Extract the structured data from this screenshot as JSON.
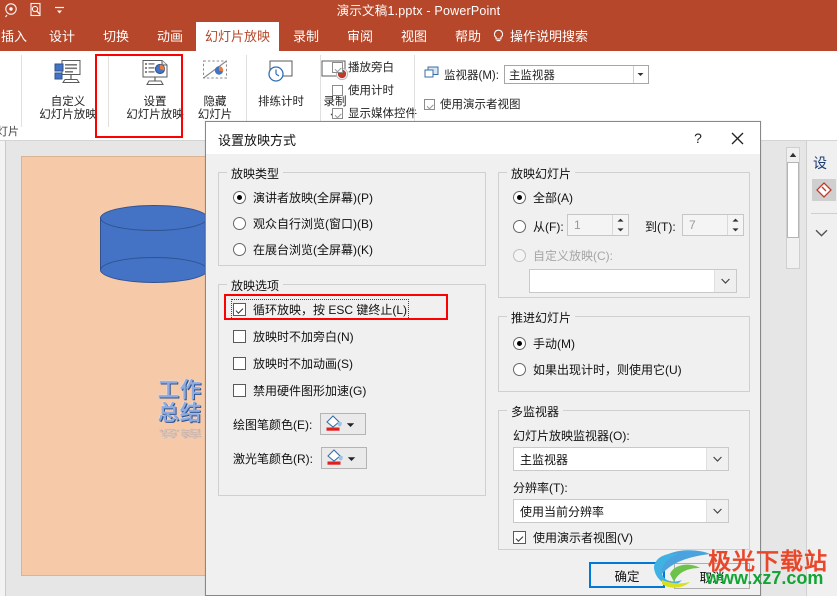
{
  "titlebar": {
    "document_title": "演示文稿1.pptx  -  PowerPoint",
    "qat": [
      "presentation-icon",
      "quick-print-preview-icon",
      "customize-qat-icon"
    ]
  },
  "tabs": [
    {
      "label": "插入",
      "active": false
    },
    {
      "label": "设计",
      "active": false
    },
    {
      "label": "切换",
      "active": false
    },
    {
      "label": "动画",
      "active": false
    },
    {
      "label": "幻灯片放映",
      "active": true
    },
    {
      "label": "录制",
      "active": false
    },
    {
      "label": "审阅",
      "active": false
    },
    {
      "label": "视图",
      "active": false
    },
    {
      "label": "帮助",
      "active": false
    }
  ],
  "tellme": {
    "label": "操作说明搜索"
  },
  "ribbon": {
    "clipped_left_label": "片",
    "group1_title": "幻灯片",
    "buttons": [
      {
        "label_top": "自定义",
        "label_bottom": "幻灯片放映",
        "icon": "custom-slideshow-icon"
      },
      {
        "label_top": "设置",
        "label_bottom": "幻灯片放映",
        "icon": "setup-slideshow-icon"
      },
      {
        "label_top": "隐藏",
        "label_bottom": "幻灯片",
        "icon": "hide-slide-icon"
      },
      {
        "label_top": "排练计时",
        "label_bottom": "",
        "icon": "rehearse-timings-icon"
      },
      {
        "label_top": "录制",
        "label_bottom": "",
        "icon": "record-icon"
      }
    ],
    "checkboxes": [
      {
        "label": "播放旁白",
        "checked": true
      },
      {
        "label": "使用计时",
        "checked": false
      },
      {
        "label": "显示媒体控件",
        "checked": true
      }
    ],
    "monitor_label": "监视器(M):",
    "monitor_value": "主监视器",
    "presenter_view_label": "使用演示者视图",
    "presenter_view_checked": true
  },
  "slide": {
    "wordart_line1": "工作",
    "wordart_line2": "总结",
    "shape": "cylinder",
    "background_color": "#f6caa8",
    "shape_color": "#4472c4"
  },
  "right_pane": {
    "title": "设",
    "swatch_icon": "fill-color-icon",
    "chevron_icon": "chevron-down-icon"
  },
  "dialog": {
    "title": "设置放映方式",
    "help_label": "?",
    "close_label": "✕",
    "show_type": {
      "legend": "放映类型",
      "options": [
        {
          "label": "演讲者放映(全屏幕)(P)",
          "selected": true
        },
        {
          "label": "观众自行浏览(窗口)(B)",
          "selected": false
        },
        {
          "label": "在展台浏览(全屏幕)(K)",
          "selected": false
        }
      ]
    },
    "show_options": {
      "legend": "放映选项",
      "items": [
        {
          "label": "循环放映，按 ESC 键终止(L)",
          "checked": true,
          "highlighted": true
        },
        {
          "label": "放映时不加旁白(N)",
          "checked": false,
          "highlighted": false
        },
        {
          "label": "放映时不加动画(S)",
          "checked": false,
          "highlighted": false
        },
        {
          "label": "禁用硬件图形加速(G)",
          "checked": false,
          "highlighted": false
        }
      ],
      "pen_color_label": "绘图笔颜色(E):",
      "laser_color_label": "激光笔颜色(R):"
    },
    "show_slides": {
      "legend": "放映幻灯片",
      "all_label": "全部(A)",
      "all_selected": true,
      "from_label": "从(F):",
      "from_value": "1",
      "to_label": "到(T):",
      "to_value": "7",
      "custom_label": "自定义放映(C):",
      "custom_selected": false,
      "custom_value": ""
    },
    "advance": {
      "legend": "推进幻灯片",
      "options": [
        {
          "label": "手动(M)",
          "selected": true
        },
        {
          "label": "如果出现计时，则使用它(U)",
          "selected": false
        }
      ]
    },
    "multi_monitor": {
      "legend": "多监视器",
      "monitor_label": "幻灯片放映监视器(O):",
      "monitor_value": "主监视器",
      "resolution_label": "分辨率(T):",
      "resolution_value": "使用当前分辨率",
      "presenter_label": "使用演示者视图(V)",
      "presenter_checked": true
    },
    "ok_label": "确定",
    "cancel_label": "取消"
  },
  "watermark": {
    "line1": "极光下载站",
    "line2": "www.xz7.com"
  },
  "colors": {
    "ribbon_accent": "#b7472a",
    "highlight_red": "#ff0000",
    "focus_blue": "#0078d7"
  }
}
